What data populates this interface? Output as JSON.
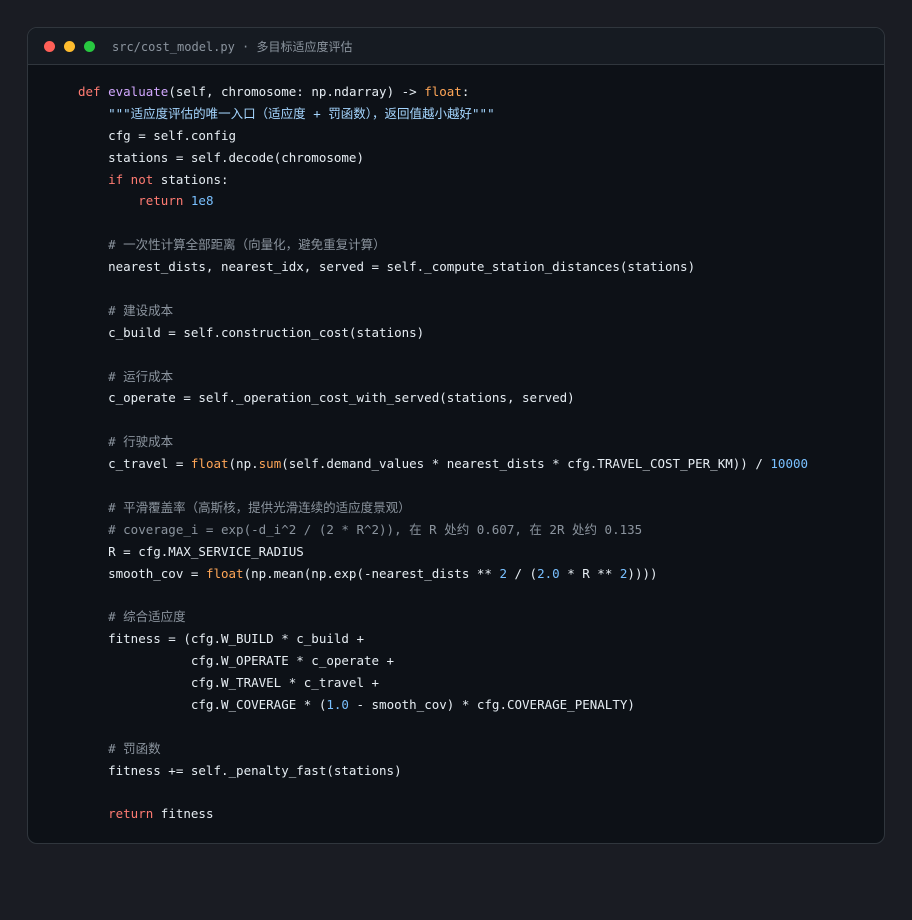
{
  "window": {
    "title": "src/cost_model.py · 多目标适应度评估"
  },
  "code_lines": [
    [
      {
        "t": "def ",
        "c": "kw"
      },
      {
        "t": "evaluate",
        "c": "fn"
      },
      {
        "t": "(self, chromosome: np.ndarray) -> ",
        "c": "tx"
      },
      {
        "t": "float",
        "c": "bi"
      },
      {
        "t": ":",
        "c": "tx"
      }
    ],
    [
      {
        "t": "    ",
        "c": "tx"
      },
      {
        "t": "\"\"\"适应度评估的唯一入口（适应度 + 罚函数），返回值越小越好\"\"\"",
        "c": "str"
      }
    ],
    [
      {
        "t": "    cfg = self.config",
        "c": "tx"
      }
    ],
    [
      {
        "t": "    stations = self.decode(chromosome)",
        "c": "tx"
      }
    ],
    [
      {
        "t": "    ",
        "c": "tx"
      },
      {
        "t": "if not",
        "c": "kw"
      },
      {
        "t": " stations:",
        "c": "tx"
      }
    ],
    [
      {
        "t": "        ",
        "c": "tx"
      },
      {
        "t": "return",
        "c": "kw"
      },
      {
        "t": " ",
        "c": "tx"
      },
      {
        "t": "1e8",
        "c": "num"
      }
    ],
    [],
    [
      {
        "t": "    # 一次性计算全部距离（向量化，避免重复计算）",
        "c": "com"
      }
    ],
    [
      {
        "t": "    nearest_dists, nearest_idx, served = self._compute_station_distances(stations)",
        "c": "tx"
      }
    ],
    [],
    [
      {
        "t": "    # 建设成本",
        "c": "com"
      }
    ],
    [
      {
        "t": "    c_build = self.construction_cost(stations)",
        "c": "tx"
      }
    ],
    [],
    [
      {
        "t": "    # 运行成本",
        "c": "com"
      }
    ],
    [
      {
        "t": "    c_operate = self._operation_cost_with_served(stations, served)",
        "c": "tx"
      }
    ],
    [],
    [
      {
        "t": "    # 行驶成本",
        "c": "com"
      }
    ],
    [
      {
        "t": "    c_travel = ",
        "c": "tx"
      },
      {
        "t": "float",
        "c": "bi"
      },
      {
        "t": "(np.",
        "c": "tx"
      },
      {
        "t": "sum",
        "c": "bi"
      },
      {
        "t": "(self.demand_values * nearest_dists * cfg.TRAVEL_COST_PER_KM)) / ",
        "c": "tx"
      },
      {
        "t": "10000",
        "c": "num"
      }
    ],
    [],
    [
      {
        "t": "    # 平滑覆盖率（高斯核，提供光滑连续的适应度景观）",
        "c": "com"
      }
    ],
    [
      {
        "t": "    # coverage_i = exp(-d_i^2 / (2 * R^2)), 在 R 处约 0.607, 在 2R 处约 0.135",
        "c": "com"
      }
    ],
    [
      {
        "t": "    R = cfg.MAX_SERVICE_RADIUS",
        "c": "tx"
      }
    ],
    [
      {
        "t": "    smooth_cov = ",
        "c": "tx"
      },
      {
        "t": "float",
        "c": "bi"
      },
      {
        "t": "(np.mean(np.exp(-nearest_dists ** ",
        "c": "tx"
      },
      {
        "t": "2",
        "c": "num"
      },
      {
        "t": " / (",
        "c": "tx"
      },
      {
        "t": "2.0",
        "c": "num"
      },
      {
        "t": " * R ** ",
        "c": "tx"
      },
      {
        "t": "2",
        "c": "num"
      },
      {
        "t": "))))",
        "c": "tx"
      }
    ],
    [],
    [
      {
        "t": "    # 综合适应度",
        "c": "com"
      }
    ],
    [
      {
        "t": "    fitness = (cfg.W_BUILD * c_build +",
        "c": "tx"
      }
    ],
    [
      {
        "t": "               cfg.W_OPERATE * c_operate +",
        "c": "tx"
      }
    ],
    [
      {
        "t": "               cfg.W_TRAVEL * c_travel +",
        "c": "tx"
      }
    ],
    [
      {
        "t": "               cfg.W_COVERAGE * (",
        "c": "tx"
      },
      {
        "t": "1.0",
        "c": "num"
      },
      {
        "t": " - smooth_cov) * cfg.COVERAGE_PENALTY)",
        "c": "tx"
      }
    ],
    [],
    [
      {
        "t": "    # 罚函数",
        "c": "com"
      }
    ],
    [
      {
        "t": "    fitness += self._penalty_fast(stations)",
        "c": "tx"
      }
    ],
    [],
    [
      {
        "t": "    ",
        "c": "tx"
      },
      {
        "t": "return",
        "c": "kw"
      },
      {
        "t": " fitness",
        "c": "tx"
      }
    ]
  ]
}
